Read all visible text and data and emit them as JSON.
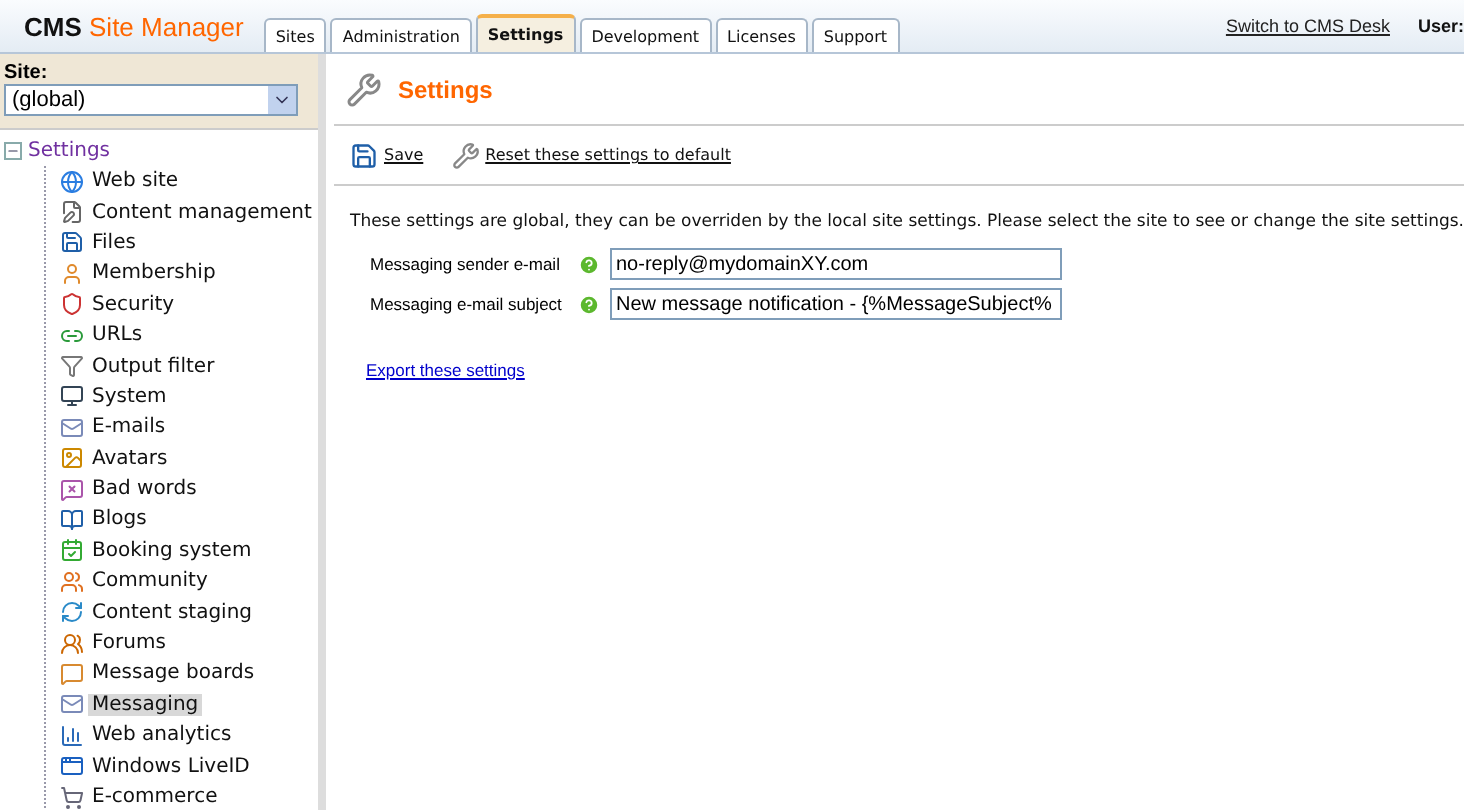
{
  "header": {
    "logo_bold": "CMS",
    "logo_rest": "Site Manager",
    "tabs": [
      {
        "label": "Sites",
        "selected": false
      },
      {
        "label": "Administration",
        "selected": false
      },
      {
        "label": "Settings",
        "selected": true
      },
      {
        "label": "Development",
        "selected": false
      },
      {
        "label": "Licenses",
        "selected": false
      },
      {
        "label": "Support",
        "selected": false
      }
    ],
    "switch_link": "Switch to CMS Desk",
    "user_label": "User:"
  },
  "sidebar": {
    "site_label": "Site:",
    "site_value": "(global)",
    "tree": {
      "label": "Settings",
      "expanded": true,
      "children": [
        {
          "label": "Web site",
          "selected": false
        },
        {
          "label": "Content management",
          "selected": false
        },
        {
          "label": "Files",
          "selected": false
        },
        {
          "label": "Membership",
          "selected": false
        },
        {
          "label": "Security",
          "selected": false
        },
        {
          "label": "URLs",
          "selected": false
        },
        {
          "label": "Output filter",
          "selected": false
        },
        {
          "label": "System",
          "selected": false
        },
        {
          "label": "E-mails",
          "selected": false
        },
        {
          "label": "Avatars",
          "selected": false
        },
        {
          "label": "Bad words",
          "selected": false
        },
        {
          "label": "Blogs",
          "selected": false
        },
        {
          "label": "Booking system",
          "selected": false
        },
        {
          "label": "Community",
          "selected": false
        },
        {
          "label": "Content staging",
          "selected": false
        },
        {
          "label": "Forums",
          "selected": false
        },
        {
          "label": "Message boards",
          "selected": false
        },
        {
          "label": "Messaging",
          "selected": true
        },
        {
          "label": "Web analytics",
          "selected": false
        },
        {
          "label": "Windows LiveID",
          "selected": false
        },
        {
          "label": "E-commerce",
          "selected": false
        }
      ]
    }
  },
  "main": {
    "title": "Settings",
    "actions": [
      {
        "label": "Save"
      },
      {
        "label": "Reset these settings to default"
      }
    ],
    "info": "These settings are global, they can be overriden by the local site settings. Please select the site to see or change the site settings.",
    "fields": [
      {
        "label": "Messaging sender e-mail",
        "value": "no-reply@mydomainXY.com"
      },
      {
        "label": "Messaging e-mail subject",
        "value": "New message notification - {%MessageSubject%"
      }
    ],
    "export_link": "Export these settings"
  }
}
